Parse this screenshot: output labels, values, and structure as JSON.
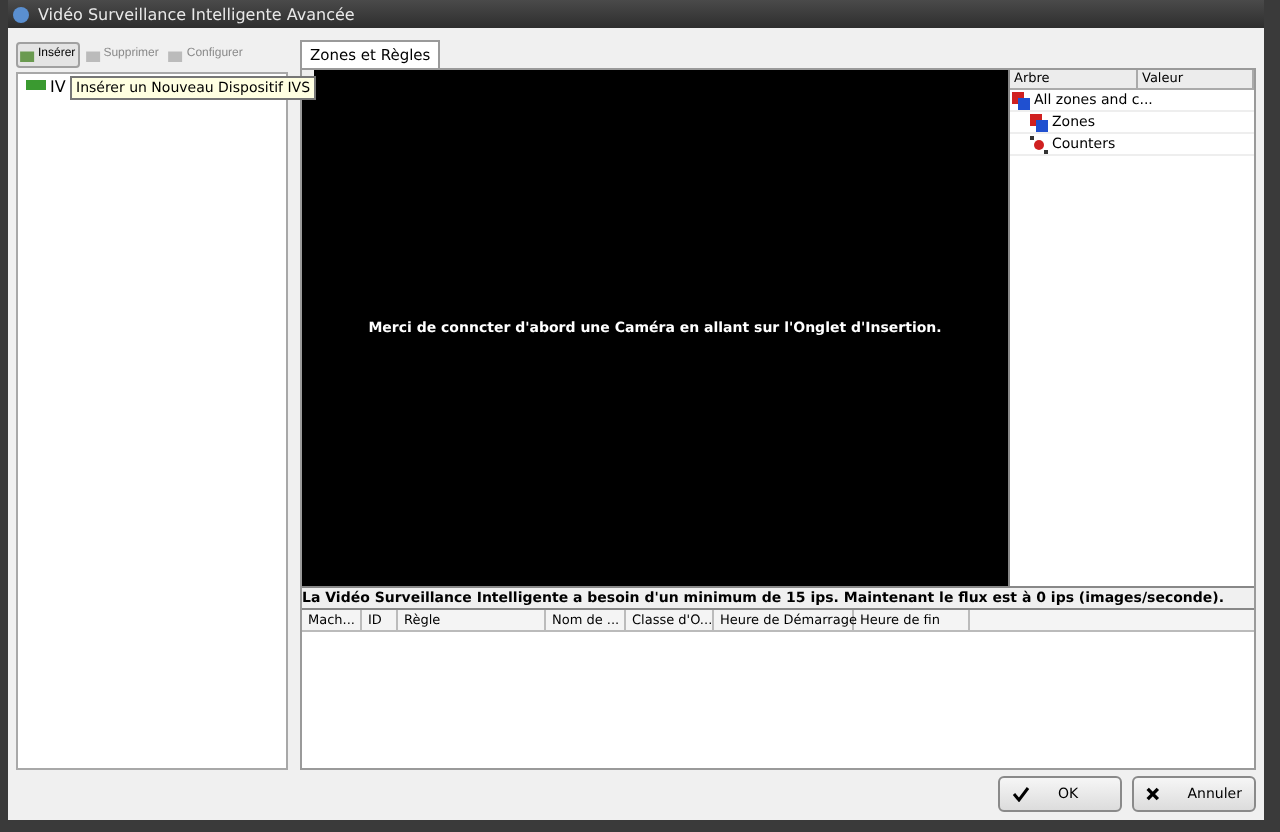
{
  "window": {
    "title": "Vidéo Surveillance Intelligente Avancée"
  },
  "toolbar": [
    {
      "label": "Insérer",
      "disabled": false
    },
    {
      "label": "Supprimer",
      "disabled": true
    },
    {
      "label": "Configurer",
      "disabled": true
    }
  ],
  "tree": {
    "items": [
      {
        "label": "IV"
      }
    ]
  },
  "tooltip": "Insérer un Nouveau Dispositif IVS",
  "tabs": [
    {
      "label": "Zones et Règles",
      "selected": true
    }
  ],
  "video": {
    "message": "Merci de conncter d'abord une Caméra en allant sur l'Onglet d'Insertion."
  },
  "properties": {
    "columns": [
      "Arbre",
      "Valeur"
    ],
    "items": [
      {
        "label": "All zones and c...",
        "children": [
          {
            "label": "Zones",
            "kind": "zones"
          },
          {
            "label": "Counters",
            "kind": "counters"
          }
        ]
      }
    ]
  },
  "status": "La Vidéo Surveillance  Intelligente a besoin d'un minimum de 15 ips. Maintenant le flux est à 0 ips (images/seconde).",
  "table": {
    "columns": [
      "Mach...",
      "ID",
      "Règle",
      "Nom de ...",
      "Classe d'O...",
      "Heure de Démarrage",
      "Heure de fin"
    ]
  },
  "buttons": [
    {
      "label": "OK",
      "kind": "ok"
    },
    {
      "label": "Annuler",
      "kind": "cancel"
    }
  ]
}
